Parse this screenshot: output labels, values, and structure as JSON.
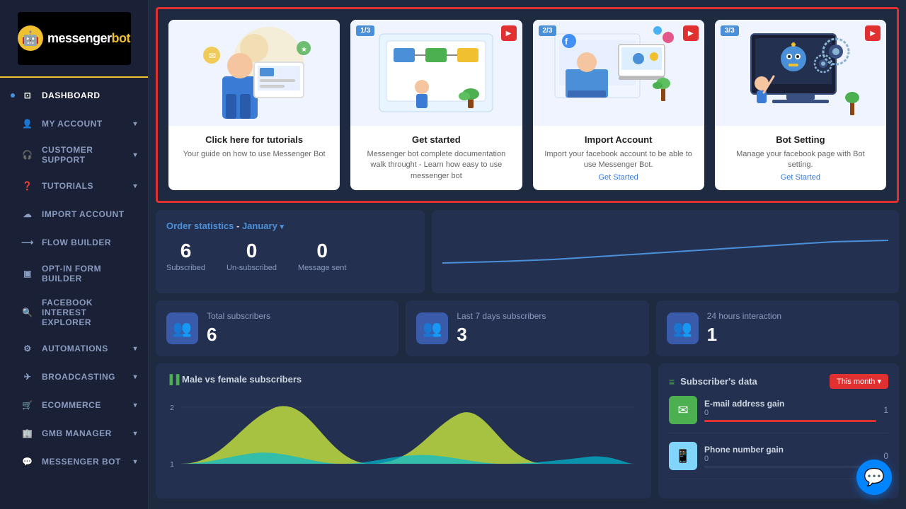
{
  "sidebar": {
    "logo": "messengerbot",
    "items": [
      {
        "id": "dashboard",
        "label": "DASHBOARD",
        "icon": "⊡",
        "hasArrow": false,
        "active": true
      },
      {
        "id": "my-account",
        "label": "MY ACCOUNT",
        "icon": "👤",
        "hasArrow": true
      },
      {
        "id": "customer-support",
        "label": "CUSTOMER SUPPORT",
        "icon": "🎧",
        "hasArrow": true
      },
      {
        "id": "tutorials",
        "label": "TUTORIALS",
        "icon": "❓",
        "hasArrow": true
      },
      {
        "id": "import-account",
        "label": "IMPORT ACCOUNT",
        "icon": "☁",
        "hasArrow": false
      },
      {
        "id": "flow-builder",
        "label": "FLOW BUILDER",
        "icon": "⟶",
        "hasArrow": false
      },
      {
        "id": "opt-in-form",
        "label": "OPT-IN FORM BUILDER",
        "icon": "▣",
        "hasArrow": false
      },
      {
        "id": "facebook-interest",
        "label": "FACEBOOK INTEREST EXPLORER",
        "icon": "🔍",
        "hasArrow": false
      },
      {
        "id": "automations",
        "label": "AUTOMATIONS",
        "icon": "⚙",
        "hasArrow": true
      },
      {
        "id": "broadcasting",
        "label": "BROADCASTING",
        "icon": "✈",
        "hasArrow": true
      },
      {
        "id": "ecommerce",
        "label": "ECOMMERCE",
        "icon": "🛒",
        "hasArrow": true
      },
      {
        "id": "gmb-manager",
        "label": "GMB MANAGER",
        "icon": "🏢",
        "hasArrow": true
      },
      {
        "id": "messenger-bot",
        "label": "MESSENGER BOT",
        "icon": "💬",
        "hasArrow": true
      }
    ]
  },
  "tutorial_cards": [
    {
      "id": "tutorials",
      "title": "Click here for tutorials",
      "desc": "Your guide on how to use Messenger Bot",
      "link": null,
      "badge": null,
      "has_play": false
    },
    {
      "id": "get-started",
      "title": "Get started",
      "desc": "Messenger bot complete documentation walk throught - Learn how easy to use messenger bot",
      "link": null,
      "badge": "1/3",
      "has_play": true
    },
    {
      "id": "import-account",
      "title": "Import Account",
      "desc": "Import your facebook account to be able to use Messenger Bot.",
      "link": "Get Started",
      "badge": "2/3",
      "has_play": true
    },
    {
      "id": "bot-setting",
      "title": "Bot Setting",
      "desc": "Manage your facebook page with Bot setting.",
      "link": "Get Started",
      "badge": "3/3",
      "has_play": true
    }
  ],
  "order_stats": {
    "title": "Order statistics",
    "month": "January",
    "subscribed": {
      "value": "6",
      "label": "Subscribed"
    },
    "unsubscribed": {
      "value": "0",
      "label": "Un-subscribed"
    },
    "message_sent": {
      "value": "0",
      "label": "Message sent"
    }
  },
  "subscriber_cards": [
    {
      "id": "total",
      "label": "Total subscribers",
      "value": "6",
      "icon": "👥"
    },
    {
      "id": "last7",
      "label": "Last 7 days subscribers",
      "value": "3",
      "icon": "👥"
    },
    {
      "id": "24h",
      "label": "24 hours interaction",
      "value": "1",
      "icon": "👥"
    }
  ],
  "male_female_chart": {
    "title": "Male vs female subscribers"
  },
  "subscriber_data": {
    "title": "Subscriber's data",
    "period_btn": "This month ▾",
    "items": [
      {
        "id": "email",
        "label": "E-mail address gain",
        "val1": "0",
        "val2": "1",
        "count": "1",
        "bar_pct": 100
      },
      {
        "id": "phone",
        "label": "Phone number gain",
        "val1": "0",
        "val2": "0",
        "count": "0",
        "bar_pct": 0
      }
    ]
  },
  "messenger_fab": "💬"
}
